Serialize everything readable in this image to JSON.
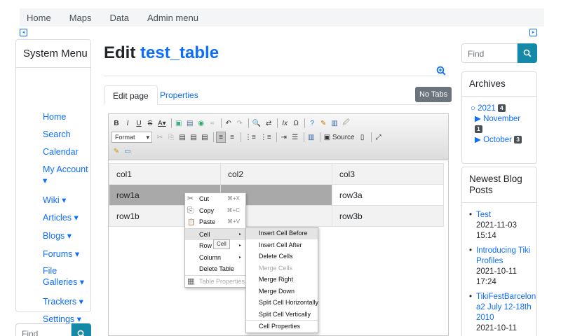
{
  "topnav": {
    "items": [
      "Home",
      "Maps",
      "Data",
      "Admin menu"
    ]
  },
  "toggles": {
    "left": "◂",
    "right": "▸"
  },
  "sidebar": {
    "title": "System Menu",
    "items": [
      "Home",
      "Search",
      "Calendar",
      "My Account ▾",
      "Wiki ▾",
      "Articles ▾",
      "Blogs ▾",
      "Forums ▾",
      "File Galleries ▾",
      "Trackers ▾",
      "Settings ▾"
    ],
    "find_placeholder": "Find"
  },
  "page": {
    "title_prefix": "Edit",
    "title_name": "test_table"
  },
  "tabs": {
    "edit": "Edit page",
    "properties": "Properties",
    "notabs": "No Tabs"
  },
  "toolbar": {
    "row1": [
      "B",
      "I",
      "U",
      "S",
      "A▾",
      "▣",
      "▤",
      "◉",
      "≈",
      "↶",
      "↷",
      "🔍",
      "⇄",
      "Ix",
      "Ω",
      "?",
      "✎",
      "▥",
      "🖉"
    ],
    "format_label": "Format",
    "source_label": "Source"
  },
  "table": {
    "rows": [
      [
        "col1",
        "col2",
        "col3"
      ],
      [
        "row1a",
        "",
        "row3a"
      ],
      [
        "row1b",
        "",
        "row3b"
      ]
    ]
  },
  "context_menu": {
    "items": [
      {
        "label": "Cut",
        "shortcut": "⌘+X",
        "icon": "✂"
      },
      {
        "label": "Copy",
        "shortcut": "⌘+C",
        "icon": "⎘"
      },
      {
        "label": "Paste",
        "shortcut": "⌘+V",
        "icon": "📋"
      },
      {
        "label": "Cell"
      },
      {
        "label": "Row"
      },
      {
        "label": "Column"
      },
      {
        "label": "Delete Table"
      },
      {
        "label": "Table Properties",
        "icon": "▦"
      }
    ],
    "tooltip": "Cell"
  },
  "cell_submenu": {
    "items": [
      "Insert Cell Before",
      "Insert Cell After",
      "Delete Cells",
      "Merge Cells",
      "Merge Right",
      "Merge Down",
      "Split Cell Horizontally",
      "Split Cell Vertically",
      "Cell Properties"
    ]
  },
  "right": {
    "find_placeholder": "Find",
    "archives_title": "Archives",
    "archive_year": "2021",
    "archive_year_count": "4",
    "months": [
      {
        "name": "November",
        "count": "1"
      },
      {
        "name": "October",
        "count": "3"
      }
    ],
    "blog_title": "Newest Blog Posts",
    "posts": [
      {
        "title": "Test",
        "date": "2021-11-03 15:14"
      },
      {
        "title": "Introducing Tiki Profiles",
        "date": "2021-10-11 17:24"
      },
      {
        "title": "TikiFestBarcelona2 July 12-18th 2010",
        "date": "2021-10-11"
      }
    ]
  }
}
